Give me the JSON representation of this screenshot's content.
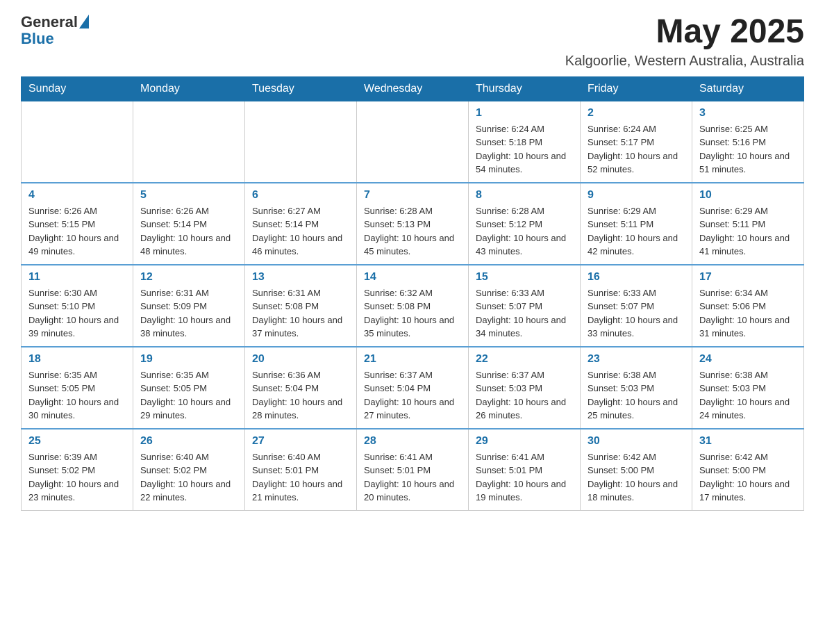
{
  "header": {
    "logo": {
      "general": "General",
      "blue": "Blue"
    },
    "title": "May 2025",
    "location": "Kalgoorlie, Western Australia, Australia"
  },
  "calendar": {
    "days_of_week": [
      "Sunday",
      "Monday",
      "Tuesday",
      "Wednesday",
      "Thursday",
      "Friday",
      "Saturday"
    ],
    "weeks": [
      [
        {
          "day": "",
          "info": ""
        },
        {
          "day": "",
          "info": ""
        },
        {
          "day": "",
          "info": ""
        },
        {
          "day": "",
          "info": ""
        },
        {
          "day": "1",
          "info": "Sunrise: 6:24 AM\nSunset: 5:18 PM\nDaylight: 10 hours and 54 minutes."
        },
        {
          "day": "2",
          "info": "Sunrise: 6:24 AM\nSunset: 5:17 PM\nDaylight: 10 hours and 52 minutes."
        },
        {
          "day": "3",
          "info": "Sunrise: 6:25 AM\nSunset: 5:16 PM\nDaylight: 10 hours and 51 minutes."
        }
      ],
      [
        {
          "day": "4",
          "info": "Sunrise: 6:26 AM\nSunset: 5:15 PM\nDaylight: 10 hours and 49 minutes."
        },
        {
          "day": "5",
          "info": "Sunrise: 6:26 AM\nSunset: 5:14 PM\nDaylight: 10 hours and 48 minutes."
        },
        {
          "day": "6",
          "info": "Sunrise: 6:27 AM\nSunset: 5:14 PM\nDaylight: 10 hours and 46 minutes."
        },
        {
          "day": "7",
          "info": "Sunrise: 6:28 AM\nSunset: 5:13 PM\nDaylight: 10 hours and 45 minutes."
        },
        {
          "day": "8",
          "info": "Sunrise: 6:28 AM\nSunset: 5:12 PM\nDaylight: 10 hours and 43 minutes."
        },
        {
          "day": "9",
          "info": "Sunrise: 6:29 AM\nSunset: 5:11 PM\nDaylight: 10 hours and 42 minutes."
        },
        {
          "day": "10",
          "info": "Sunrise: 6:29 AM\nSunset: 5:11 PM\nDaylight: 10 hours and 41 minutes."
        }
      ],
      [
        {
          "day": "11",
          "info": "Sunrise: 6:30 AM\nSunset: 5:10 PM\nDaylight: 10 hours and 39 minutes."
        },
        {
          "day": "12",
          "info": "Sunrise: 6:31 AM\nSunset: 5:09 PM\nDaylight: 10 hours and 38 minutes."
        },
        {
          "day": "13",
          "info": "Sunrise: 6:31 AM\nSunset: 5:08 PM\nDaylight: 10 hours and 37 minutes."
        },
        {
          "day": "14",
          "info": "Sunrise: 6:32 AM\nSunset: 5:08 PM\nDaylight: 10 hours and 35 minutes."
        },
        {
          "day": "15",
          "info": "Sunrise: 6:33 AM\nSunset: 5:07 PM\nDaylight: 10 hours and 34 minutes."
        },
        {
          "day": "16",
          "info": "Sunrise: 6:33 AM\nSunset: 5:07 PM\nDaylight: 10 hours and 33 minutes."
        },
        {
          "day": "17",
          "info": "Sunrise: 6:34 AM\nSunset: 5:06 PM\nDaylight: 10 hours and 31 minutes."
        }
      ],
      [
        {
          "day": "18",
          "info": "Sunrise: 6:35 AM\nSunset: 5:05 PM\nDaylight: 10 hours and 30 minutes."
        },
        {
          "day": "19",
          "info": "Sunrise: 6:35 AM\nSunset: 5:05 PM\nDaylight: 10 hours and 29 minutes."
        },
        {
          "day": "20",
          "info": "Sunrise: 6:36 AM\nSunset: 5:04 PM\nDaylight: 10 hours and 28 minutes."
        },
        {
          "day": "21",
          "info": "Sunrise: 6:37 AM\nSunset: 5:04 PM\nDaylight: 10 hours and 27 minutes."
        },
        {
          "day": "22",
          "info": "Sunrise: 6:37 AM\nSunset: 5:03 PM\nDaylight: 10 hours and 26 minutes."
        },
        {
          "day": "23",
          "info": "Sunrise: 6:38 AM\nSunset: 5:03 PM\nDaylight: 10 hours and 25 minutes."
        },
        {
          "day": "24",
          "info": "Sunrise: 6:38 AM\nSunset: 5:03 PM\nDaylight: 10 hours and 24 minutes."
        }
      ],
      [
        {
          "day": "25",
          "info": "Sunrise: 6:39 AM\nSunset: 5:02 PM\nDaylight: 10 hours and 23 minutes."
        },
        {
          "day": "26",
          "info": "Sunrise: 6:40 AM\nSunset: 5:02 PM\nDaylight: 10 hours and 22 minutes."
        },
        {
          "day": "27",
          "info": "Sunrise: 6:40 AM\nSunset: 5:01 PM\nDaylight: 10 hours and 21 minutes."
        },
        {
          "day": "28",
          "info": "Sunrise: 6:41 AM\nSunset: 5:01 PM\nDaylight: 10 hours and 20 minutes."
        },
        {
          "day": "29",
          "info": "Sunrise: 6:41 AM\nSunset: 5:01 PM\nDaylight: 10 hours and 19 minutes."
        },
        {
          "day": "30",
          "info": "Sunrise: 6:42 AM\nSunset: 5:00 PM\nDaylight: 10 hours and 18 minutes."
        },
        {
          "day": "31",
          "info": "Sunrise: 6:42 AM\nSunset: 5:00 PM\nDaylight: 10 hours and 17 minutes."
        }
      ]
    ]
  }
}
